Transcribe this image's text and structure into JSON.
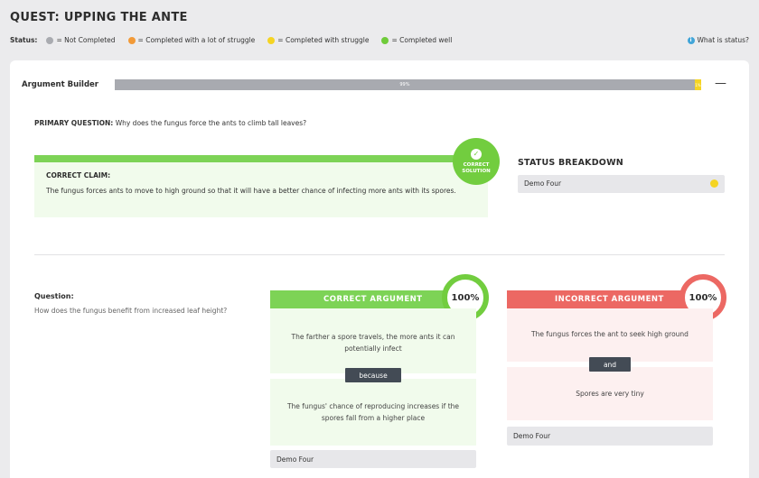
{
  "header": {
    "title": "QUEST: UPPING THE ANTE",
    "status_label": "Status:",
    "legend": [
      {
        "color": "#a9abb0",
        "label": "= Not Completed"
      },
      {
        "color": "#f29a38",
        "label": "= Completed with a lot of struggle"
      },
      {
        "color": "#f5d423",
        "label": "= Completed with struggle"
      },
      {
        "color": "#6fcb3a",
        "label": "= Completed well"
      }
    ],
    "help_link": "What is status?",
    "help_icon": "info-icon"
  },
  "argument_builder": {
    "label": "Argument Builder",
    "progress_gray_label": "99%",
    "progress_gray_fraction": 0.989,
    "progress_yellow_label": "1%",
    "progress_yellow_fraction": 0.011,
    "collapse_symbol": "—"
  },
  "primary_question": {
    "label": "PRIMARY QUESTION:",
    "text": "Why does the fungus force the ants to climb tall leaves?"
  },
  "correct_claim": {
    "badge_text_line1": "CORRECT",
    "badge_text_line2": "SOLUTION",
    "check_symbol": "✓",
    "title": "CORRECT CLAIM:",
    "text": "The fungus forces ants to move to high ground so that it will have a better chance of infecting more ants with its spores."
  },
  "status_breakdown": {
    "title": "STATUS BREAKDOWN",
    "student": "Demo Four",
    "status_color": "#f5d423"
  },
  "question": {
    "label": "Question:",
    "text": "How does the fungus benefit from increased leaf height?"
  },
  "correct_argument": {
    "header": "CORRECT ARGUMENT",
    "percent": "100%",
    "statement1": "The farther a spore travels, the more ants it can potentially infect",
    "connector": "because",
    "statement2": "The fungus' chance of reproducing increases if the spores fall from a higher place",
    "student": "Demo Four"
  },
  "incorrect_argument": {
    "header": "INCORRECT ARGUMENT",
    "percent": "100%",
    "statement1": "The fungus forces the ant to seek high ground",
    "connector": "and",
    "statement2": "Spores are very tiny",
    "student": "Demo Four"
  }
}
